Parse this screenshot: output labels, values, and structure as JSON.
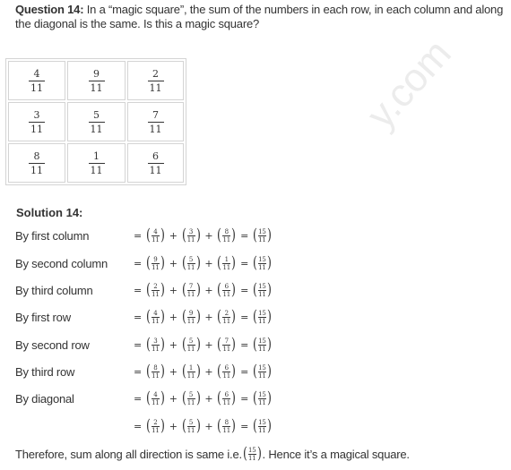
{
  "question": {
    "label": "Question 14:",
    "text": " In a “magic square”, the sum of the numbers in each row, in each column and along the diagonal is the same. Is this a magic square?"
  },
  "magic_square": {
    "rows": [
      [
        {
          "num": "4",
          "den": "11"
        },
        {
          "num": "9",
          "den": "11"
        },
        {
          "num": "2",
          "den": "11"
        }
      ],
      [
        {
          "num": "3",
          "den": "11"
        },
        {
          "num": "5",
          "den": "11"
        },
        {
          "num": "7",
          "den": "11"
        }
      ],
      [
        {
          "num": "8",
          "den": "11"
        },
        {
          "num": "1",
          "den": "11"
        },
        {
          "num": "6",
          "den": "11"
        }
      ]
    ]
  },
  "solution": {
    "title": "Solution 14:",
    "lines": [
      {
        "label": "By first column",
        "terms": [
          "4",
          "3",
          "8"
        ],
        "den": "11",
        "result": "15"
      },
      {
        "label": "By second column",
        "terms": [
          "9",
          "5",
          "1"
        ],
        "den": "11",
        "result": "15"
      },
      {
        "label": "By third column",
        "terms": [
          "2",
          "7",
          "6"
        ],
        "den": "11",
        "result": "15"
      },
      {
        "label": "By first row",
        "terms": [
          "4",
          "9",
          "2"
        ],
        "den": "11",
        "result": "15"
      },
      {
        "label": "By second row",
        "terms": [
          "3",
          "5",
          "7"
        ],
        "den": "11",
        "result": "15"
      },
      {
        "label": "By third row",
        "terms": [
          "8",
          "1",
          "6"
        ],
        "den": "11",
        "result": "15"
      },
      {
        "label": "By diagonal",
        "terms": [
          "4",
          "5",
          "6"
        ],
        "den": "11",
        "result": "15"
      },
      {
        "label": "",
        "terms": [
          "2",
          "5",
          "8"
        ],
        "den": "11",
        "result": "15"
      }
    ],
    "symbols": {
      "equals": "=",
      "plus": "+",
      "open": "(",
      "close": ")"
    }
  },
  "conclusion": {
    "before": "Therefore, sum along all direction is same i.e. ",
    "num": "15",
    "den": "11",
    "after": ". Hence it’s a magical square."
  },
  "watermark": {
    "text": "y.com"
  }
}
